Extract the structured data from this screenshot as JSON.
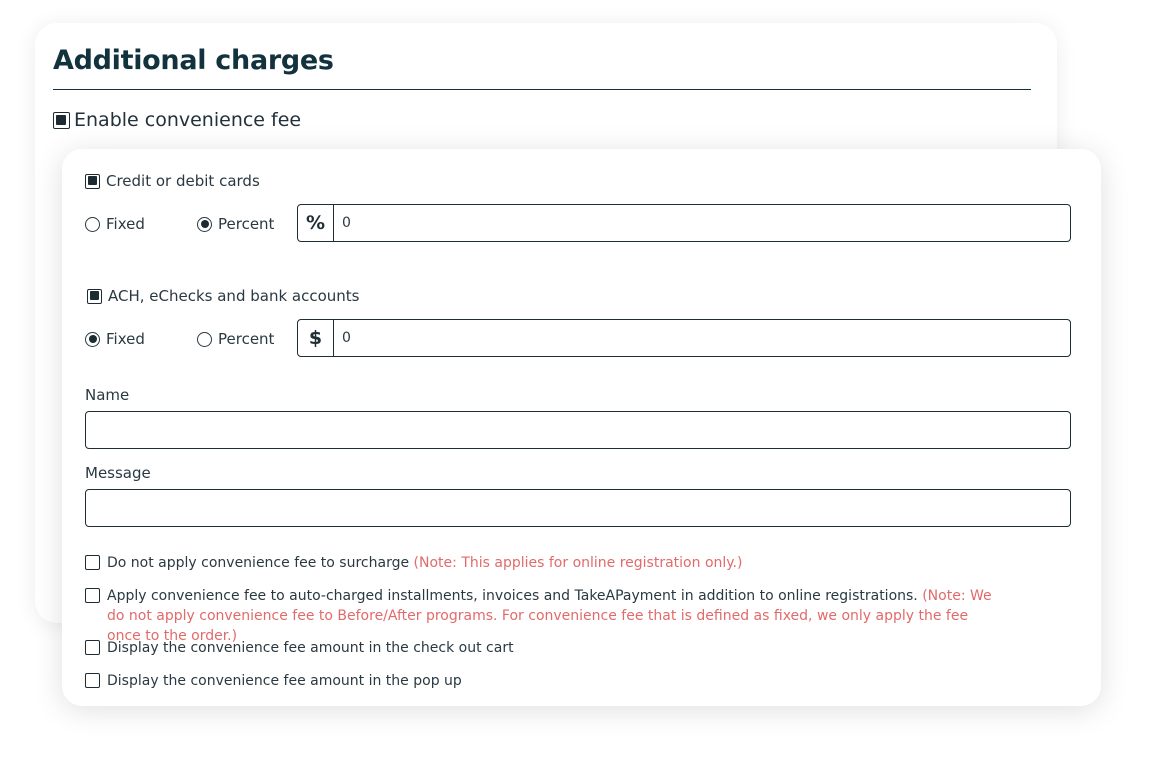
{
  "section": {
    "title": "Additional charges",
    "enable_label": "Enable convenience fee",
    "enable_checked": true
  },
  "credit_cards": {
    "label": "Credit or debit cards",
    "checked": true,
    "options": [
      "Fixed",
      "Percent"
    ],
    "selected": "Percent",
    "addon_symbol": "%",
    "value": "0"
  },
  "ach": {
    "label": "ACH, eChecks and bank accounts",
    "checked": true,
    "options": [
      "Fixed",
      "Percent"
    ],
    "selected": "Fixed",
    "addon_symbol": "$",
    "value": "0"
  },
  "name_field": {
    "label": "Name",
    "value": ""
  },
  "message_field": {
    "label": "Message",
    "value": ""
  },
  "options": [
    {
      "label": "Do not apply convenience fee to surcharge",
      "note": "(Note: This applies for online registration only.)",
      "checked": false
    },
    {
      "label": "Apply convenience fee to auto-charged installments, invoices and TakeAPayment in addition to online registrations.",
      "note": "(Note: We do not apply convenience fee to Before/After programs. For convenience fee that is defined as fixed, we only apply the fee once to the order.)",
      "checked": false
    },
    {
      "label": "Display the convenience fee amount in the check out cart",
      "note": "",
      "checked": false
    },
    {
      "label": "Display the convenience fee amount in the pop up",
      "note": "",
      "checked": false
    }
  ],
  "colors": {
    "heading": "#12323d",
    "text": "#2a3941",
    "note": "#e26a6a",
    "border": "#1f2d35"
  }
}
